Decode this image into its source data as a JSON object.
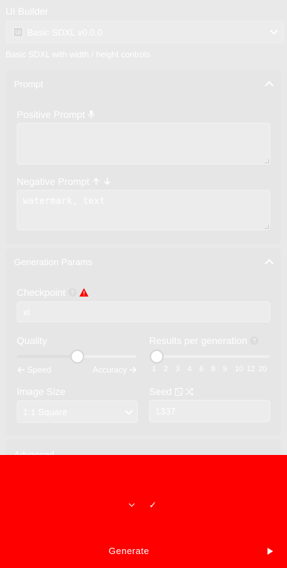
{
  "header": {
    "label": "UI Builder",
    "badge": "UI",
    "selected": "Basic SDXL v0.0.0",
    "description": "Basic SDXL with width / height controls"
  },
  "prompt_panel": {
    "title": "Prompt",
    "positive_label": "Positive Prompt",
    "positive_value": "",
    "negative_label": "Negative Prompt",
    "negative_value": "watermark, text"
  },
  "gen_panel": {
    "title": "Generation Params",
    "checkpoint_label": "Checkpoint",
    "checkpoint_value": "xl",
    "quality_label": "Quality",
    "quality_min_label": "Speed",
    "quality_max_label": "Accuracy",
    "quality_level": 0.5,
    "results_label": "Results per generation",
    "results_ticks": [
      "1",
      "2",
      "3",
      "4",
      "6",
      "8",
      "9",
      "10",
      "12",
      "20"
    ],
    "results_value": "1",
    "image_size_label": "Image Size",
    "image_size_value": "1:1 Square",
    "seed_label": "Seed",
    "seed_value": "1337"
  },
  "advanced": {
    "title": "Advanced"
  },
  "footer": {
    "generate_label": "Generate",
    "left_select": "",
    "check_label": "✓"
  },
  "colors": {
    "background": "#e9e9e9",
    "footer": "#ff0000",
    "warning": "#ff0000"
  }
}
